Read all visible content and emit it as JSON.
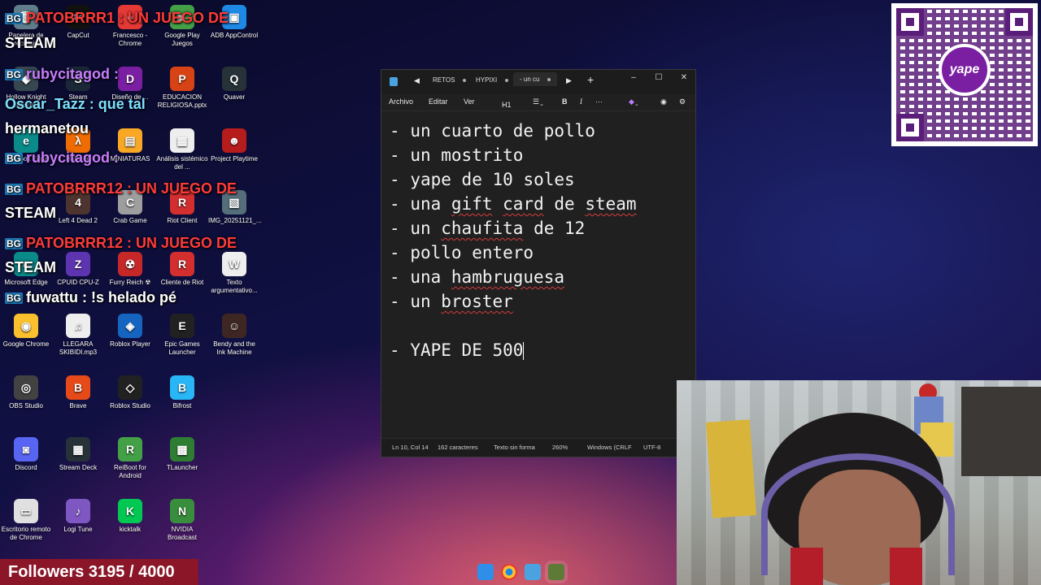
{
  "desktop": {
    "icons": [
      {
        "label": "Papelera de reciclaje",
        "glyph": "🗑",
        "color": "#607d8b"
      },
      {
        "label": "CapCut",
        "glyph": "✂",
        "color": "#111111"
      },
      {
        "label": "Francesco - Chrome",
        "glyph": "●",
        "color": "#e53935"
      },
      {
        "label": "Google Play Juegos",
        "glyph": "▶",
        "color": "#43a047"
      },
      {
        "label": "ADB AppControl",
        "glyph": "▣",
        "color": "#1e88e5"
      },
      {
        "label": "Hollow Knight Silksong",
        "glyph": "◆",
        "color": "#37474f"
      },
      {
        "label": "Steam",
        "glyph": "S",
        "color": "#1b2838"
      },
      {
        "label": "Diseño de ...",
        "glyph": "D",
        "color": "#7b1fa2"
      },
      {
        "label": "EDUCACION RELIGIOSA.pptx",
        "glyph": "P",
        "color": "#d84315"
      },
      {
        "label": "Quaver",
        "glyph": "Q",
        "color": "#263238"
      },
      {
        "label": "Microsoft Edge",
        "glyph": "e",
        "color": "#0b8a8a"
      },
      {
        "label": "Half-Life",
        "glyph": "λ",
        "color": "#ef6c00"
      },
      {
        "label": "MINIATURAS",
        "glyph": "▤",
        "color": "#f9a825"
      },
      {
        "label": "Análisis sistémico del ...",
        "glyph": "▦",
        "color": "#eeeeee"
      },
      {
        "label": "Project Playtime",
        "glyph": "☻",
        "color": "#b71c1c"
      },
      {
        "label": "Left 4 Dead 2",
        "glyph": "4",
        "color": "#4e342e"
      },
      {
        "label": "Crab Game",
        "glyph": "C",
        "color": "#9e9e9e"
      },
      {
        "label": "Riot Client",
        "glyph": "R",
        "color": "#d32f2f"
      },
      {
        "label": "IMG_20251121_...",
        "glyph": "▧",
        "color": "#546e7a"
      },
      {
        "label": "Microsoft Edge",
        "glyph": "e",
        "color": "#0b8a8a"
      },
      {
        "label": "CPUID CPU-Z",
        "glyph": "Z",
        "color": "#5e35b1"
      },
      {
        "label": "Furry Reich ☢",
        "glyph": "☢",
        "color": "#c62828"
      },
      {
        "label": "Cliente de Riot",
        "glyph": "R",
        "color": "#d32f2f"
      },
      {
        "label": "Texto argumentativo...",
        "glyph": "W",
        "color": "#eeeeee"
      },
      {
        "label": "Google Chrome",
        "glyph": "◉",
        "color": "#fbc02d"
      },
      {
        "label": "LLEGARA SKIBIDI.mp3",
        "glyph": "♫",
        "color": "#eeeeee"
      },
      {
        "label": "Roblox Player",
        "glyph": "◈",
        "color": "#1565c0"
      },
      {
        "label": "Epic Games Launcher",
        "glyph": "E",
        "color": "#212121"
      },
      {
        "label": "Bendy and the Ink Machine",
        "glyph": "☺",
        "color": "#3e2723"
      },
      {
        "label": "OBS Studio",
        "glyph": "◎",
        "color": "#424242"
      },
      {
        "label": "Brave",
        "glyph": "B",
        "color": "#e64a19"
      },
      {
        "label": "Roblox Studio",
        "glyph": "◇",
        "color": "#212121"
      },
      {
        "label": "Bifrost",
        "glyph": "B",
        "color": "#29b6f6"
      },
      {
        "label": "Discord",
        "glyph": "◙",
        "color": "#5865f2"
      },
      {
        "label": "Stream Deck",
        "glyph": "▦",
        "color": "#263238"
      },
      {
        "label": "ReiBoot for Android",
        "glyph": "R",
        "color": "#43a047"
      },
      {
        "label": "TLauncher",
        "glyph": "▩",
        "color": "#2e7d32"
      },
      {
        "label": "Escritorio remoto de Chrome",
        "glyph": "▭",
        "color": "#e0e0e0"
      },
      {
        "label": "Logi Tune",
        "glyph": "♪",
        "color": "#7e57c2"
      },
      {
        "label": "kicktalk",
        "glyph": "K",
        "color": "#00c853"
      },
      {
        "label": "NVIDIA Broadcast",
        "glyph": "N",
        "color": "#388e3c"
      }
    ]
  },
  "chat": [
    {
      "badge": "BG",
      "text": "PATOBRRR1 : UN JUEGO DE",
      "color": "#ff3b3b"
    },
    {
      "badge": "",
      "text": "STEAM",
      "color": "#ffffff"
    },
    {
      "badge": "BG",
      "text": "rubycitagod :",
      "color": "#c77dff"
    },
    {
      "badge": "",
      "text": "Oscar_Tazz : que tal",
      "color": "#7ee0ff"
    },
    {
      "badge": "",
      "text": "hermanetou",
      "color": "#ffffff"
    },
    {
      "badge": "BG",
      "text": "rubycitagod :",
      "color": "#c77dff"
    },
    {
      "badge": "BG",
      "text": "PATOBRRR12 : UN JUEGO DE",
      "color": "#ff3b3b"
    },
    {
      "badge": "",
      "text": "STEAM",
      "color": "#ffffff"
    },
    {
      "badge": "BG",
      "text": "PATOBRRR12 : UN JUEGO DE",
      "color": "#ff3b3b"
    },
    {
      "badge": "",
      "text": "STEAM",
      "color": "#ffffff"
    },
    {
      "badge": "BG",
      "text": "fuwattu : !s helado pé",
      "color": "#ffffff"
    }
  ],
  "qr": {
    "logo_text": "yape"
  },
  "notepad": {
    "tabs": [
      "RETOS",
      "HYPIXI",
      "- un cu"
    ],
    "menu": [
      "Archivo",
      "Editar",
      "Ver"
    ],
    "heading_selector": "H1",
    "lines": [
      {
        "text": "- un cuarto de pollo",
        "misspelled": []
      },
      {
        "text": "- un mostrito",
        "misspelled": []
      },
      {
        "text": "- yape de 10 soles",
        "misspelled": []
      },
      {
        "text": "- una gift card de steam",
        "misspelled": [
          "gift",
          "card",
          "steam"
        ]
      },
      {
        "text": "- un chaufita de 12",
        "misspelled": [
          "chaufita"
        ]
      },
      {
        "text": "- pollo entero",
        "misspelled": []
      },
      {
        "text": "- una hambruguesa",
        "misspelled": [
          "hambruguesa"
        ]
      },
      {
        "text": "- un broster",
        "misspelled": [
          "broster"
        ]
      },
      {
        "text": "",
        "misspelled": []
      },
      {
        "text": "- YAPE DE 500",
        "misspelled": []
      }
    ],
    "status": {
      "position": "Ln 10, Col 14",
      "chars": "162 caracteres",
      "format": "Texto sin forma",
      "zoom": "260%",
      "line_endings": "Windows (CRLF",
      "encoding": "UTF-8"
    }
  },
  "followers": {
    "text": "Followers 3195 / 4000",
    "current": 3195,
    "goal": 4000
  }
}
